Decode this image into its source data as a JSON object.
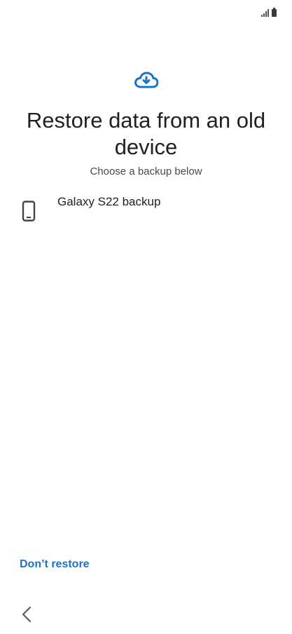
{
  "status_bar": {
    "signal_icon": "signal-bars-icon",
    "battery_icon": "battery-icon"
  },
  "header": {
    "icon": "cloud-download-icon",
    "icon_color": "#1a73c8",
    "title": "Restore data from an old device",
    "subtitle": "Choose a backup below"
  },
  "backups": [
    {
      "icon": "smartphone-icon",
      "label": "Galaxy S22 backup"
    }
  ],
  "footer": {
    "dont_restore_label": "Don’t restore",
    "dont_restore_color": "#1a73c8",
    "back_icon": "chevron-left-icon"
  }
}
